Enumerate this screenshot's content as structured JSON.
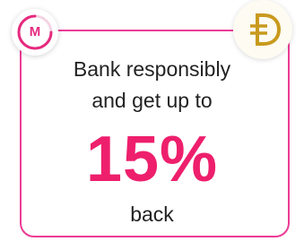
{
  "promo": {
    "line1": "Bank responsibly",
    "line2": "and get up to",
    "percent": "15%",
    "line3": "back"
  },
  "badges": {
    "left_letter": "M",
    "left_icon": "m-ring-badge-icon",
    "right_icon": "dash-d-coin-icon"
  },
  "colors": {
    "accent_pink": "#ee1f6c",
    "border_pink": "#ec3c96",
    "coin_gold": "#c99a1e"
  }
}
